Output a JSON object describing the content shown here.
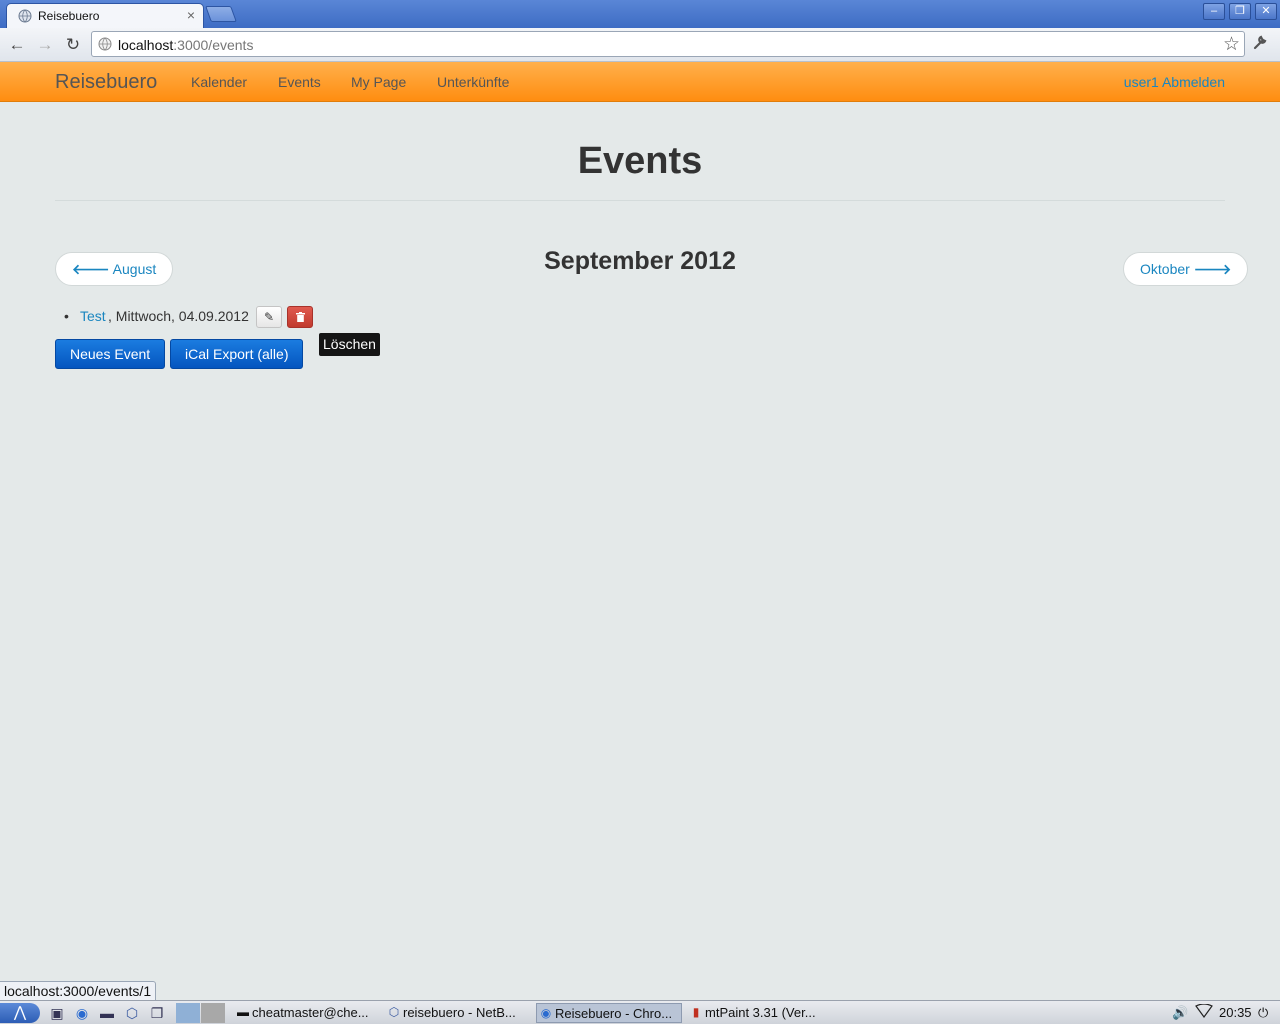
{
  "browser": {
    "tab_title": "Reisebuero",
    "tab_close": "×",
    "url_host": "localhost",
    "url_path": ":3000/events",
    "window_controls": {
      "minimize": "–",
      "restore": "❐",
      "close": "✕"
    },
    "nav": {
      "back": "←",
      "forward": "→",
      "reload": "↻"
    },
    "star": "☆",
    "wrench": "🔧"
  },
  "navbar": {
    "brand": "Reisebuero",
    "links": [
      "Kalender",
      "Events",
      "My Page",
      "Unterkünfte"
    ],
    "user": "user1",
    "logout": "Abmelden"
  },
  "page": {
    "title": "Events",
    "month_heading": "September 2012",
    "prev_month": "August",
    "next_month": "Oktober",
    "events": [
      {
        "name": "Test",
        "date_text": ", Mittwoch, 04.09.2012"
      }
    ],
    "edit_icon": "✎",
    "delete_icon": "🗑",
    "new_event_button": "Neues Event",
    "ical_export_button": "iCal Export (alle)",
    "tooltip": "Löschen"
  },
  "statusbar": {
    "link_url": "localhost:3000/events/1"
  },
  "taskbar": {
    "tasks": [
      {
        "label": "cheatmaster@che...",
        "icon": "terminal-icon",
        "active": false
      },
      {
        "label": "reisebuero - NetB...",
        "icon": "netbeans-icon",
        "active": false
      },
      {
        "label": "Reisebuero - Chro...",
        "icon": "chromium-icon",
        "active": true
      },
      {
        "label": "mtPaint 3.31 (Ver...",
        "icon": "mtpaint-icon",
        "active": false
      }
    ],
    "clock": "20:35"
  },
  "colors": {
    "navbar_orange": "#ff9c2a",
    "link_blue": "#1a86c0",
    "primary_button": "#0a64d0",
    "danger_button": "#c9403a",
    "page_background": "#e4e9e9"
  }
}
